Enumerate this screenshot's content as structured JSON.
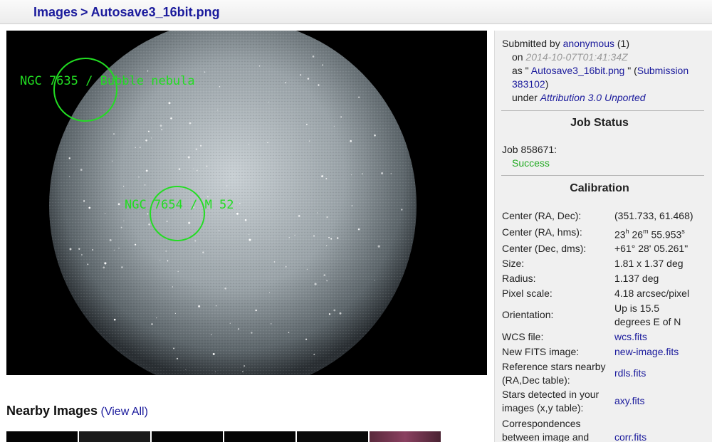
{
  "breadcrumb": {
    "root": "Images",
    "separator": ">",
    "current": "Autosave3_16bit.png"
  },
  "image": {
    "annotations": [
      {
        "label": "NGC 7635 / Bubble nebula",
        "color": "#22dd22"
      },
      {
        "label": "NGC 7654 / M 52",
        "color": "#22dd22"
      }
    ]
  },
  "nearby": {
    "heading": "Nearby Images",
    "view_all": "(View All)"
  },
  "submission": {
    "submitted_by_prefix": "Submitted by",
    "user": "anonymous",
    "user_count": "(1)",
    "on_prefix": "on",
    "date": "2014-10-07T01:41:34Z",
    "as_prefix": "as \"",
    "filename": "Autosave3_16bit.png",
    "as_suffix": "\" (",
    "submission_part1": "Submission",
    "submission_part2": "383102",
    "close_paren": ")",
    "under_prefix": "under",
    "license": "Attribution 3.0 Unported"
  },
  "job": {
    "title": "Job Status",
    "job_label": "Job 858671:",
    "status": "Success"
  },
  "calibration": {
    "title": "Calibration",
    "center_radec_label": "Center (RA, Dec):",
    "center_radec_value": "(351.733, 61.468)",
    "center_hms_label": "Center (RA, hms):",
    "ra_h": "23",
    "ra_h_unit": "h",
    "ra_m": "26",
    "ra_m_unit": "m",
    "ra_s": "55.953",
    "ra_s_unit": "s",
    "center_dms_label": "Center (Dec, dms):",
    "center_dms_value": "+61° 28' 05.261\"",
    "size_label": "Size:",
    "size_value": "1.81 x 1.37 deg",
    "radius_label": "Radius:",
    "radius_value": "1.137 deg",
    "pixel_scale_label": "Pixel scale:",
    "pixel_scale_value": "4.18 arcsec/pixel",
    "orientation_label": "Orientation:",
    "orientation_value_1": "Up is 15.5",
    "orientation_value_2": "degrees E of N",
    "wcs_label": "WCS file:",
    "wcs_link": "wcs.fits",
    "newfits_label": "New FITS image:",
    "newfits_link": "new-image.fits",
    "refstars_label_1": "Reference stars nearby",
    "refstars_label_2": "(RA,Dec table):",
    "refstars_link": "rdls.fits",
    "detected_label_1": "Stars detected in your",
    "detected_label_2": "images (x,y table):",
    "detected_link": "axy.fits",
    "corr_label_1": "Correspondences",
    "corr_label_2": "between image and",
    "corr_link": "corr.fits"
  }
}
